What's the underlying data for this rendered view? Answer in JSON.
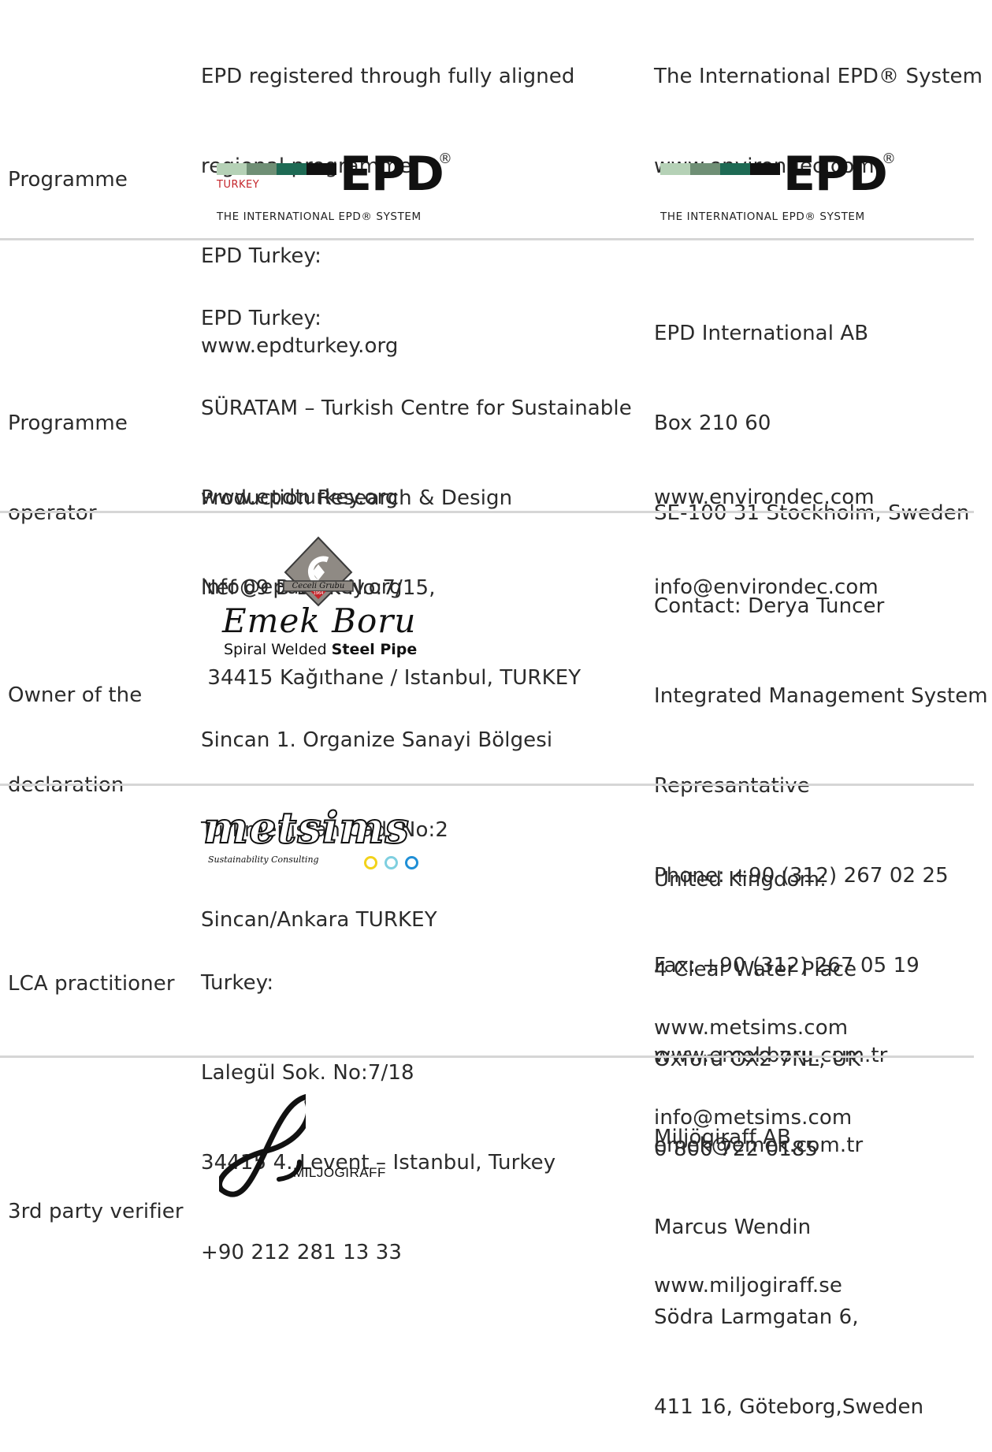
{
  "rows": {
    "programme": {
      "label": [
        "Programme"
      ],
      "col2": [
        "EPD registered through fully aligned",
        "regional programme:",
        "EPD Turkey:",
        "www.epdturkey.org"
      ],
      "col3": [
        "The International EPD® System",
        "www.environdec.com"
      ],
      "logo_turkey": {
        "word": "EPD",
        "reg": "®",
        "tag": "TURKEY",
        "sub": "THE INTERNATIONAL EPD® SYSTEM"
      },
      "logo_intl": {
        "word": "EPD",
        "reg": "®",
        "sub": "THE INTERNATIONAL EPD® SYSTEM"
      },
      "logo_colors": [
        "#b5d1b6",
        "#6f8f75",
        "#1e6a54",
        "#111111"
      ]
    },
    "operator": {
      "label": [
        "Programme",
        "operator"
      ],
      "col2_address": [
        "EPD Turkey:",
        "SÜRATAM – Turkish Centre for Sustainable",
        "Production Research & Design",
        "Nef 09 B Blok No:7/15,",
        " 34415 Kağıthane / Istanbul, TURKEY"
      ],
      "col2_web": [
        "www.epdturkey.org",
        "info@epdturkey.org"
      ],
      "col3_address": [
        "EPD International AB",
        "Box 210 60",
        "SE-100 31 Stockholm, Sweden"
      ],
      "col3_web": [
        "www.environdec.com",
        "info@environdec.com"
      ]
    },
    "owner": {
      "label": [
        "Owner of the",
        "declaration"
      ],
      "logo": {
        "banner": "Ceceli Grubu",
        "year": "1964",
        "word": "Emek Boru",
        "sub_light": "Spiral Welded ",
        "sub_bold": "Steel Pipe"
      },
      "col2": [
        "Sincan 1. Organize Sanayi Bölgesi",
        "Türkmenistan Cad. No:2",
        "Sincan/Ankara TURKEY"
      ],
      "col3": [
        "Contact: Derya Tuncer",
        "Integrated Management System",
        "Represantative",
        "Phone: +90 (312) 267 02 25",
        "Fax: +90 (312) 267 05 19",
        "www.emekboru.com.tr",
        "emek@emek.com.tr"
      ]
    },
    "lca": {
      "label": [
        "LCA practitioner"
      ],
      "logo": {
        "word": "metsims",
        "sub": "Sustainability Consulting",
        "ring_colors": [
          "#f2d21b",
          "#7fcfe0",
          "#1f8fd6"
        ]
      },
      "col2": [
        "Turkey:",
        "Lalegül Sok. No:7/18",
        "34415 4. Levent – Istanbul, Turkey",
        "+90 212 281 13 33"
      ],
      "col3_address": [
        "United Kingdom:",
        "4 Clear Water Place",
        "Oxford OX2 7NL, UK",
        "0 800 722 0185"
      ],
      "col3_web": [
        "www.metsims.com",
        "info@metsims.com"
      ]
    },
    "verifier": {
      "label": [
        "3rd party verifier"
      ],
      "logo": {
        "word": "MILJÖGIRAFF"
      },
      "col3_address": [
        "Miljögiraff AB",
        "Marcus Wendin",
        "Södra Larmgatan 6,",
        "411 16, Göteborg,Sweden"
      ],
      "col3_web": [
        "www.miljogiraff.se"
      ]
    }
  }
}
